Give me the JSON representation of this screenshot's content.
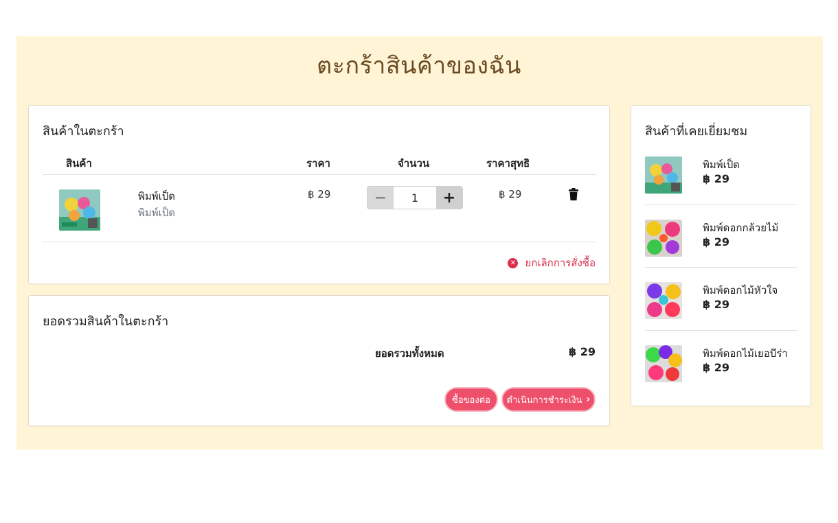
{
  "page": {
    "title": "ตะกร้าสินค้าของฉัน"
  },
  "cart": {
    "title": "สินค้าในตะกร้า",
    "headers": {
      "product": "สินค้า",
      "price": "ราคา",
      "quantity": "จำนวน",
      "net_price": "ราคาสุทธิ"
    },
    "items": [
      {
        "name": "พิมพ์เป็ด",
        "subtitle": "พิมพ์เป็ด",
        "price": "฿ 29",
        "quantity": "1",
        "net_price": "฿ 29"
      }
    ],
    "stepper": {
      "minus": "−",
      "plus": "+"
    },
    "cancel_label": "ยกเลิกการสั่งซื้อ",
    "trash_icon": "trash-icon"
  },
  "summary": {
    "title": "ยอดรวมสินค้าในตะกร้า",
    "total_label": "ยอดรวมทั้งหมด",
    "total_value": "฿ 29",
    "continue_label": "ซื้อของต่อ",
    "checkout_label": "ดำเนินการชำระเงิน",
    "checkout_icon": "chevron-right-icon"
  },
  "visited": {
    "title": "สินค้าที่เคยเยี่ยมชม",
    "items": [
      {
        "name": "พิมพ์เป็ด",
        "price": "฿ 29"
      },
      {
        "name": "พิมพ์ดอกกล้วยไม้",
        "price": "฿ 29"
      },
      {
        "name": "พิมพ์ดอกไม้หัวใจ",
        "price": "฿ 29"
      },
      {
        "name": "พิมพ์ดอกไม้เยอบีร่า",
        "price": "฿ 29"
      }
    ]
  },
  "colors": {
    "page_bg": "#fff5d6",
    "title": "#6b4a22",
    "accent": "#ee4f6b",
    "danger": "#d9304d"
  }
}
